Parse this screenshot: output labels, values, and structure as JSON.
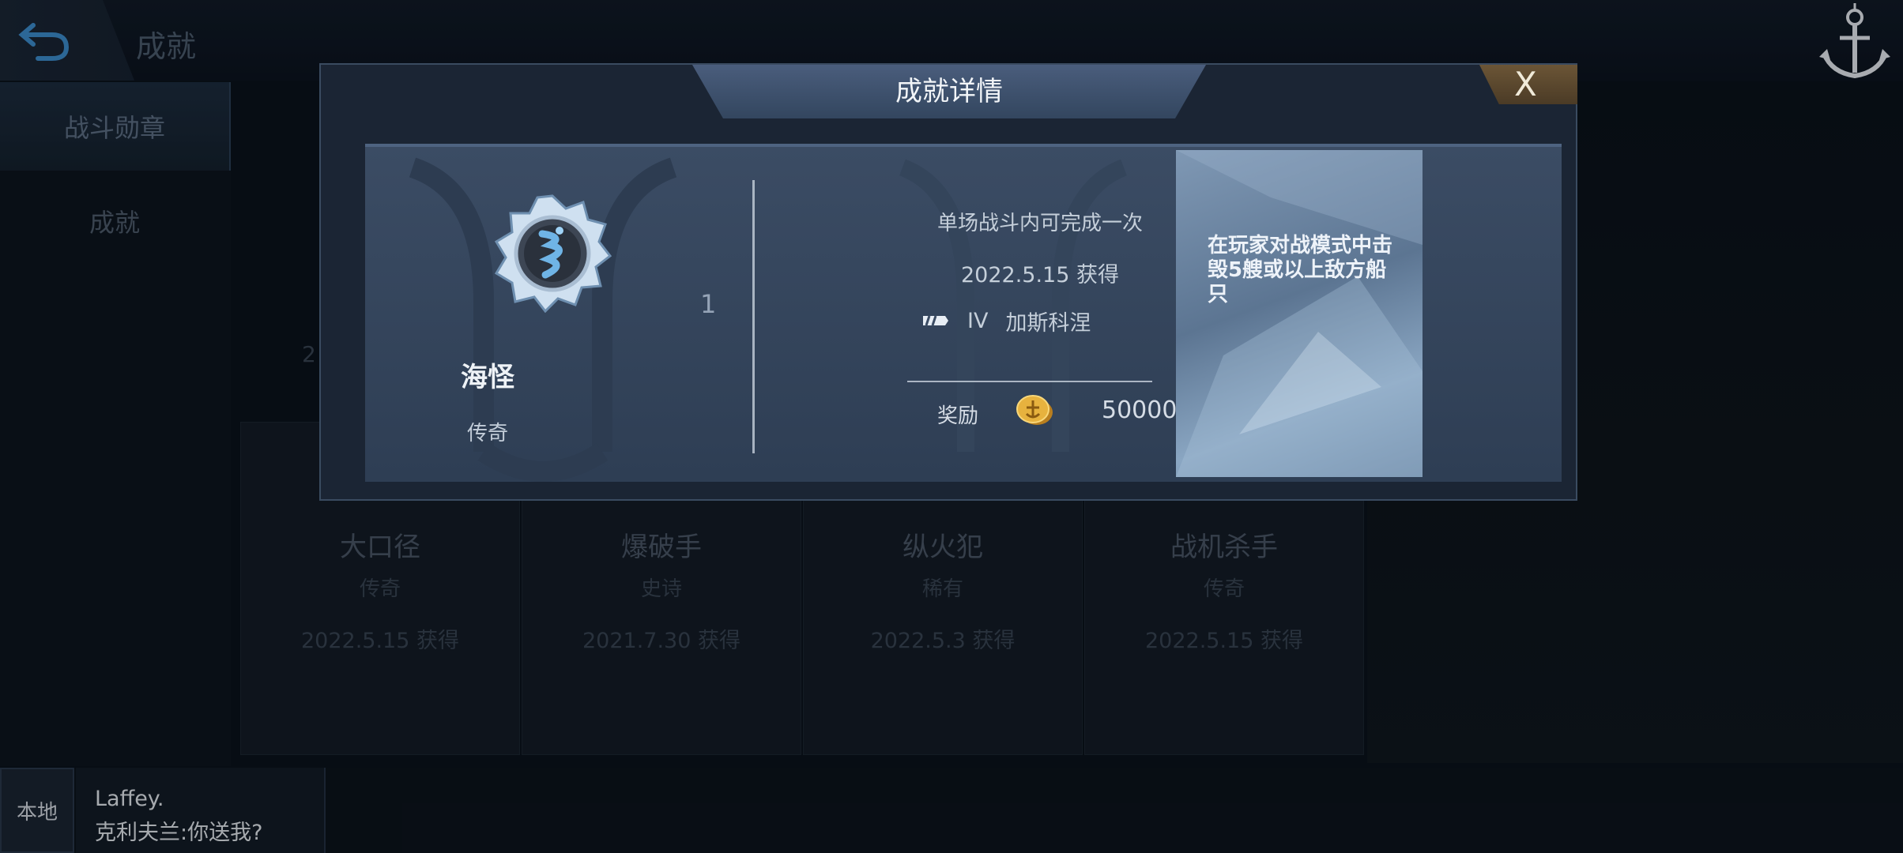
{
  "header": {
    "title": "成就"
  },
  "sidebar": {
    "items": [
      {
        "label": "战斗勋章"
      },
      {
        "label": "成就"
      }
    ]
  },
  "cards": [
    {
      "name": "大口径",
      "rarity": "传奇",
      "date": "2022.5.15 获得"
    },
    {
      "name": "爆破手",
      "rarity": "史诗",
      "date": "2021.7.30 获得"
    },
    {
      "name": "纵火犯",
      "rarity": "稀有",
      "date": "2022.5.3  获得"
    },
    {
      "name": "战机杀手",
      "rarity": "传奇",
      "date": "2022.5.15 获得"
    }
  ],
  "partial_text": "2",
  "modal": {
    "title": "成就详情",
    "close_label": "X",
    "medal": {
      "name": "海怪",
      "rarity": "传奇",
      "count": "1"
    },
    "condition": "单场战斗内可完成一次",
    "date": "2022.5.15 获得",
    "ship": {
      "tier": "IV",
      "name": "加斯科涅"
    },
    "reward": {
      "label": "奖励",
      "value": "50000"
    },
    "description": "在玩家对战模式中击毁5艘或以上敌方船只"
  },
  "chat": {
    "channel": "本地",
    "user": "Laffey.",
    "message": "克利夫兰:你送我?"
  },
  "colors": {
    "accent": "#3b4c64",
    "close": "#6b5536",
    "coin": "#e0a73a"
  },
  "icons": {
    "back": "back-arrow-icon",
    "anchor": "anchor-icon",
    "coin": "coin-icon",
    "ship": "ship-class-icon"
  }
}
